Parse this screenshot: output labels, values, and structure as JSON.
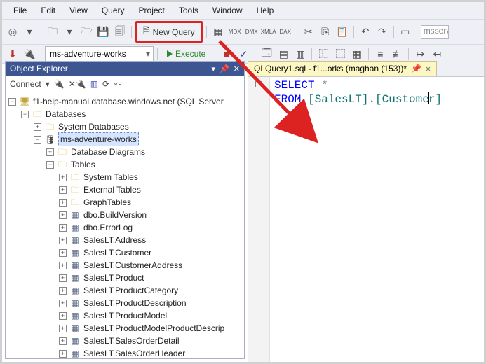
{
  "menu": [
    "File",
    "Edit",
    "View",
    "Query",
    "Project",
    "Tools",
    "Window",
    "Help"
  ],
  "toolbar1": {
    "new_query_label": "New Query",
    "search_placeholder": "msservi"
  },
  "toolbar2": {
    "db_selected": "ms-adventure-works",
    "execute_label": "Execute"
  },
  "object_explorer": {
    "title": "Object Explorer",
    "connect_label": "Connect",
    "server_label": "f1-help-manual.database.windows.net (SQL Server ",
    "databases_label": "Databases",
    "sysdb_label": "System Databases",
    "db_label": "ms-adventure-works",
    "dbdiag_label": "Database Diagrams",
    "tables_label": "Tables",
    "table_children": [
      "System Tables",
      "External Tables",
      "GraphTables",
      "dbo.BuildVersion",
      "dbo.ErrorLog",
      "SalesLT.Address",
      "SalesLT.Customer",
      "SalesLT.CustomerAddress",
      "SalesLT.Product",
      "SalesLT.ProductCategory",
      "SalesLT.ProductDescription",
      "SalesLT.ProductModel",
      "SalesLT.ProductModelProductDescrip",
      "SalesLT.SalesOrderDetail",
      "SalesLT.SalesOrderHeader"
    ]
  },
  "editor": {
    "tab_label": "QLQuery1.sql - f1...orks (maghan (153))*",
    "code_select": "SELECT",
    "code_star": " *",
    "code_from": "FROM",
    "code_obj1": "[SalesLT]",
    "code_dot": ".",
    "code_obj2a": "[Custome",
    "code_obj2b": "r]"
  }
}
